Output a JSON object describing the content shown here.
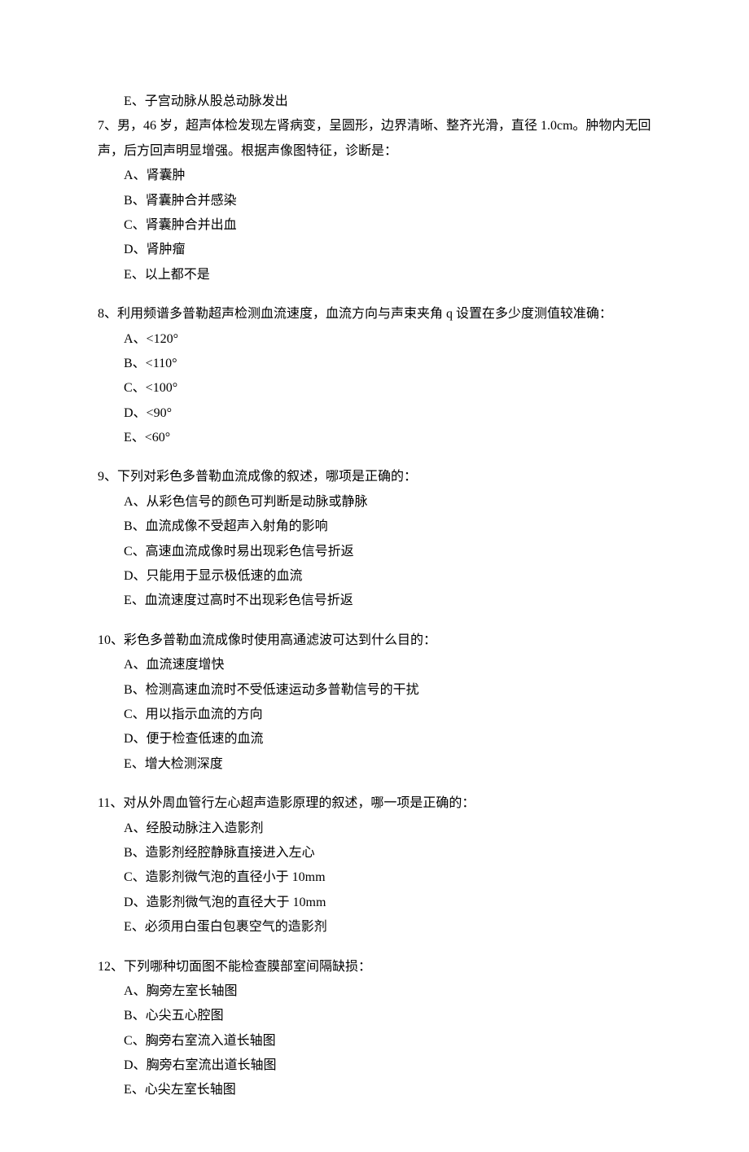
{
  "orphan_option": "E、子宫动脉从股总动脉发出",
  "questions": [
    {
      "num": "7、",
      "stem": "男，46 岁，超声体检发现左肾病变，呈圆形，边界清晰、整齐光滑，直径 1.0cm。肿物内无回声，后方回声明显增强。根据声像图特征，诊断是：",
      "opts": [
        "A、肾囊肿",
        "B、肾囊肿合并感染",
        "C、肾囊肿合并出血",
        "D、肾肿瘤",
        "E、以上都不是"
      ]
    },
    {
      "num": "8、",
      "stem": "利用频谱多普勒超声检测血流速度，血流方向与声束夹角 q 设置在多少度测值较准确：",
      "opts": [
        "A、<120°",
        "B、<110°",
        "C、<100°",
        "D、<90°",
        "E、<60°"
      ]
    },
    {
      "num": "9、",
      "stem": "下列对彩色多普勒血流成像的叙述，哪项是正确的：",
      "opts": [
        "A、从彩色信号的颜色可判断是动脉或静脉",
        "B、血流成像不受超声入射角的影响",
        "C、高速血流成像时易出现彩色信号折返",
        "D、只能用于显示极低速的血流",
        "E、血流速度过高时不出现彩色信号折返"
      ]
    },
    {
      "num": "10、",
      "stem": "彩色多普勒血流成像时使用高通滤波可达到什么目的：",
      "opts": [
        "A、血流速度增快",
        "B、检测高速血流时不受低速运动多普勒信号的干扰",
        "C、用以指示血流的方向",
        "D、便于检查低速的血流",
        "E、增大检测深度"
      ]
    },
    {
      "num": "11、",
      "stem": "对从外周血管行左心超声造影原理的叙述，哪一项是正确的：",
      "opts": [
        "A、经股动脉注入造影剂",
        "B、造影剂经腔静脉直接进入左心",
        "C、造影剂微气泡的直径小于 10mm",
        "D、造影剂微气泡的直径大于 10mm",
        "E、必须用白蛋白包裹空气的造影剂"
      ]
    },
    {
      "num": "12、",
      "stem": "下列哪种切面图不能检查膜部室间隔缺损：",
      "opts": [
        "A、胸旁左室长轴图",
        "B、心尖五心腔图",
        "C、胸旁右室流入道长轴图",
        "D、胸旁右室流出道长轴图",
        "E、心尖左室长轴图"
      ]
    }
  ]
}
